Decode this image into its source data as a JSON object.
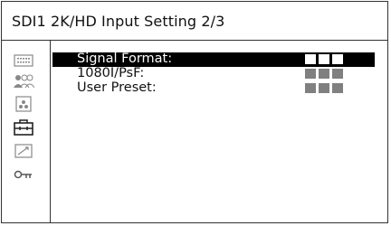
{
  "title": "SDI1 2K/HD Input Setting 2/3",
  "sidebar": {
    "icons": [
      "screen-icon",
      "users-icon",
      "camera-icon",
      "toolbox-icon",
      "chart-icon",
      "key-icon"
    ]
  },
  "settings": [
    {
      "label": "Signal Format:",
      "value_boxes": 3,
      "selected": true
    },
    {
      "label": "1080I/PsF:",
      "value_boxes": 3,
      "selected": false
    },
    {
      "label": "User Preset:",
      "value_boxes": 3,
      "selected": false
    }
  ],
  "colors": {
    "selected_bg": "#000000",
    "value_box": "#808080",
    "frame": "#333333"
  }
}
